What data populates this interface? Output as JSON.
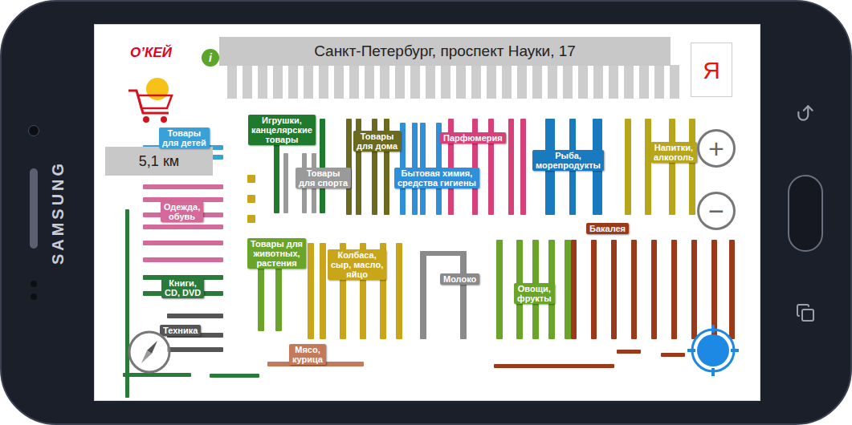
{
  "device": {
    "brand": "SAMSUNG"
  },
  "header": {
    "logo": "О’КЕЙ",
    "info": "i",
    "address": "Санкт-Петербург, проспект Науки, 17",
    "yandex": "Я"
  },
  "distance": "5,1 км",
  "zoom": {
    "in": "+",
    "out": "−"
  },
  "categories": [
    {
      "lines": [
        "Товары",
        "для детей"
      ],
      "color": "#3aa0d8"
    },
    {
      "lines": [
        "Игрушки,",
        "канцелярские",
        "товары"
      ],
      "color": "#1f7a2e"
    },
    {
      "lines": [
        "Товары",
        "для дома"
      ],
      "color": "#6b6a1f"
    },
    {
      "lines": [
        "Парфюмерия"
      ],
      "color": "#d6417a"
    },
    {
      "lines": [
        "Рыба,",
        "морепродукты"
      ],
      "color": "#1a7ac0"
    },
    {
      "lines": [
        "Напитки,",
        "алкоголь"
      ],
      "color": "#b8a61a"
    },
    {
      "lines": [
        "Товары",
        "для спорта"
      ],
      "color": "#9a9a9a"
    },
    {
      "lines": [
        "Бытовая химия,",
        "средства гигиены"
      ],
      "color": "#2f8fd8"
    },
    {
      "lines": [
        "Одежда,",
        "обувь"
      ],
      "color": "#d46a9a"
    },
    {
      "lines": [
        "Бакалея"
      ],
      "color": "#9a3a1a"
    },
    {
      "lines": [
        "Товары для",
        "животных,",
        "растения"
      ],
      "color": "#6aa52a"
    },
    {
      "lines": [
        "Колбаса,",
        "сыр, масло,",
        "яйцо"
      ],
      "color": "#c9a51a"
    },
    {
      "lines": [
        "Молоко"
      ],
      "color": "#8a8a8a"
    },
    {
      "lines": [
        "Овощи,",
        "фрукты"
      ],
      "color": "#6aa52a"
    },
    {
      "lines": [
        "Книги,",
        "CD, DVD"
      ],
      "color": "#2a7a3a"
    },
    {
      "lines": [
        "Техника"
      ],
      "color": "#555555"
    },
    {
      "lines": [
        "Мясо,",
        "курица"
      ],
      "color": "#c47a5a"
    }
  ]
}
